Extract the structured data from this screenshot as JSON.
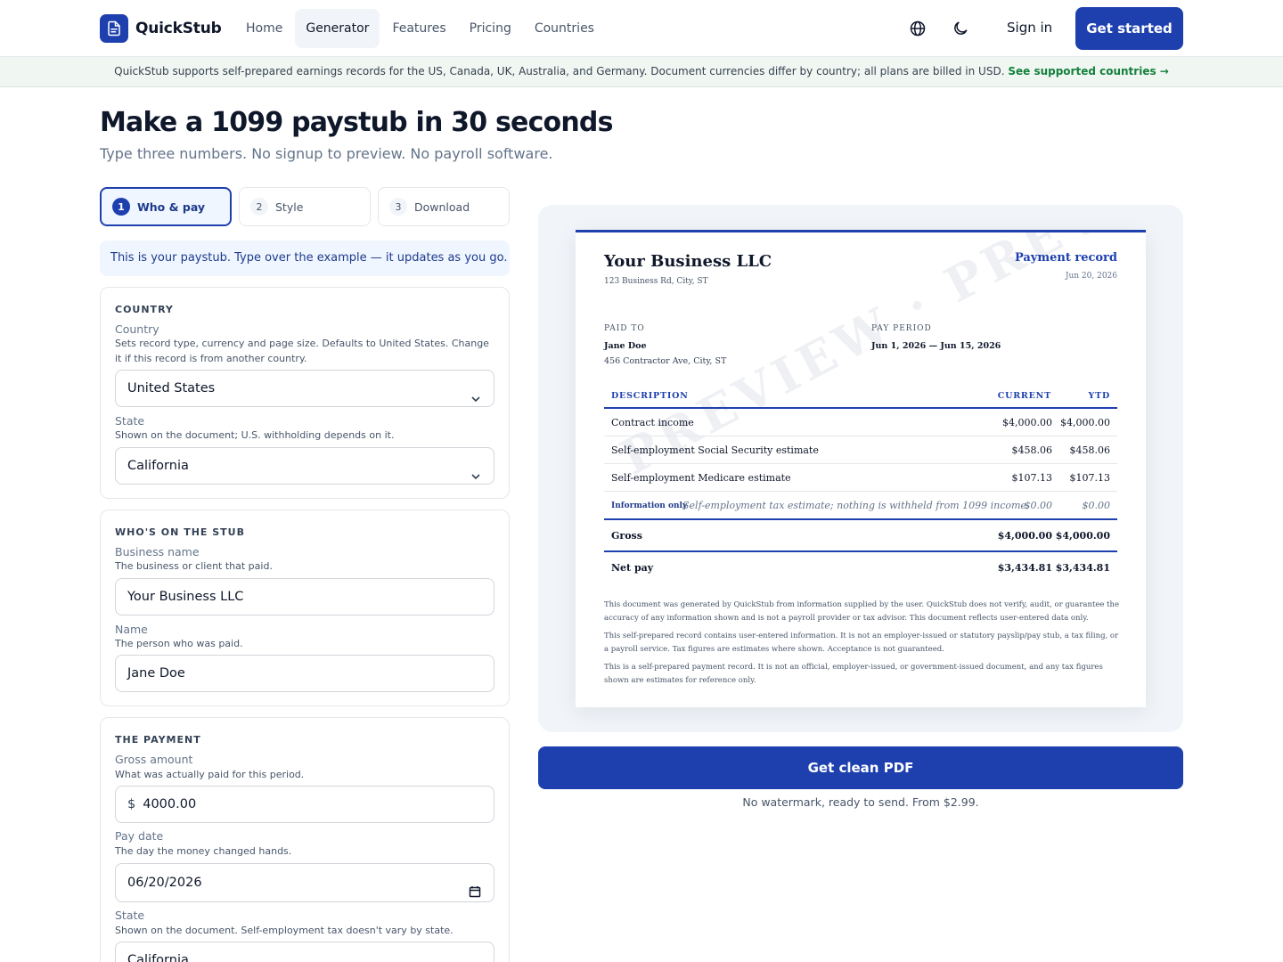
{
  "brand": {
    "name": "QuickStub"
  },
  "nav": {
    "items": [
      "Home",
      "Generator",
      "Features",
      "Pricing",
      "Countries"
    ],
    "active": "Generator"
  },
  "header": {
    "signin": "Sign in",
    "get_started": "Get started",
    "icons": [
      "globe-icon",
      "moon-icon"
    ]
  },
  "banner": {
    "text": "QuickStub supports self-prepared earnings records for the US, Canada, UK, Australia, and Germany. Document currencies differ by country; all plans are billed in USD.",
    "link": "See supported countries →"
  },
  "page": {
    "title": "Make a 1099 paystub in 30 seconds",
    "subtitle": "Type three numbers. No signup to preview. No payroll software."
  },
  "steps": [
    {
      "num": "1",
      "label": "Who & pay"
    },
    {
      "num": "2",
      "label": "Style"
    },
    {
      "num": "3",
      "label": "Download"
    }
  ],
  "hint": "This is your paystub. Type over the example — it updates as you go.",
  "country_section": {
    "title": "COUNTRY",
    "country_label": "Country",
    "country_desc": "Sets record type, currency and page size. Defaults to United States. Change it if this record is from another country.",
    "country_value": "United States",
    "state_label": "State",
    "state_desc": "Shown on the document; U.S. withholding depends on it.",
    "state_value": "California"
  },
  "who_section": {
    "title": "WHO'S ON THE STUB",
    "business_label": "Business name",
    "business_desc": "The business or client that paid.",
    "business_value": "Your Business LLC",
    "name_label": "Name",
    "name_desc": "The person who was paid.",
    "name_value": "Jane Doe"
  },
  "payment_section": {
    "title": "THE PAYMENT",
    "gross_label": "Gross amount",
    "gross_desc": "What was actually paid for this period.",
    "currency_symbol": "$",
    "gross_value": "4000.00",
    "date_label": "Pay date",
    "date_desc": "The day the money changed hands.",
    "date_value": "06/20/2026",
    "state_label": "State",
    "state_desc": "Shown on the document. Self-employment tax doesn't vary by state.",
    "state_value": "California"
  },
  "document": {
    "business": "Your Business LLC",
    "business_address": "123 Business Rd, City, ST",
    "record_title": "Payment record",
    "record_date": "Jun 20, 2026",
    "paid_to_label": "PAID TO",
    "payee": "Jane Doe",
    "payee_address": "456 Contractor Ave, City, ST",
    "period_label": "PAY PERIOD",
    "period": "Jun 1, 2026 — Jun 15, 2026",
    "columns": [
      "DESCRIPTION",
      "CURRENT",
      "YTD"
    ],
    "rows": [
      {
        "desc": "Contract income",
        "current": "$4,000.00",
        "ytd": "$4,000.00"
      },
      {
        "desc": "Self-employment Social Security estimate",
        "current": "$458.06",
        "ytd": "$458.06"
      },
      {
        "desc": "Self-employment Medicare estimate",
        "current": "$107.13",
        "ytd": "$107.13"
      }
    ],
    "info_row": {
      "tag": "Information only",
      "desc": "Self-employment tax estimate; nothing is withheld from 1099 income.",
      "current": "$0.00",
      "ytd": "$0.00"
    },
    "gross": {
      "label": "Gross",
      "current": "$4,000.00",
      "ytd": "$4,000.00"
    },
    "net": {
      "label": "Net pay",
      "current": "$3,434.81",
      "ytd": "$3,434.81"
    },
    "disclaimers": [
      "This document was generated by QuickStub from information supplied by the user. QuickStub does not verify, audit, or guarantee the accuracy of any information shown and is not a payroll provider or tax advisor. This document reflects user-entered data only.",
      "This self-prepared record contains user-entered information. It is not an employer-issued or statutory payslip/pay stub, a tax filing, or a payroll service. Tax figures are estimates where shown. Acceptance is not guaranteed.",
      "This is a self-prepared payment record. It is not an official, employer-issued, or government-issued document, and any tax figures shown are estimates for reference only."
    ],
    "watermark": "PREVIEW · PREVIEW"
  },
  "cta": {
    "button": "Get clean PDF",
    "note": "No watermark, ready to send. From $2.99."
  },
  "colors": {
    "accent": "#1e40af",
    "banner_link": "#15803d",
    "banner_bg": "#f0f7f2"
  }
}
